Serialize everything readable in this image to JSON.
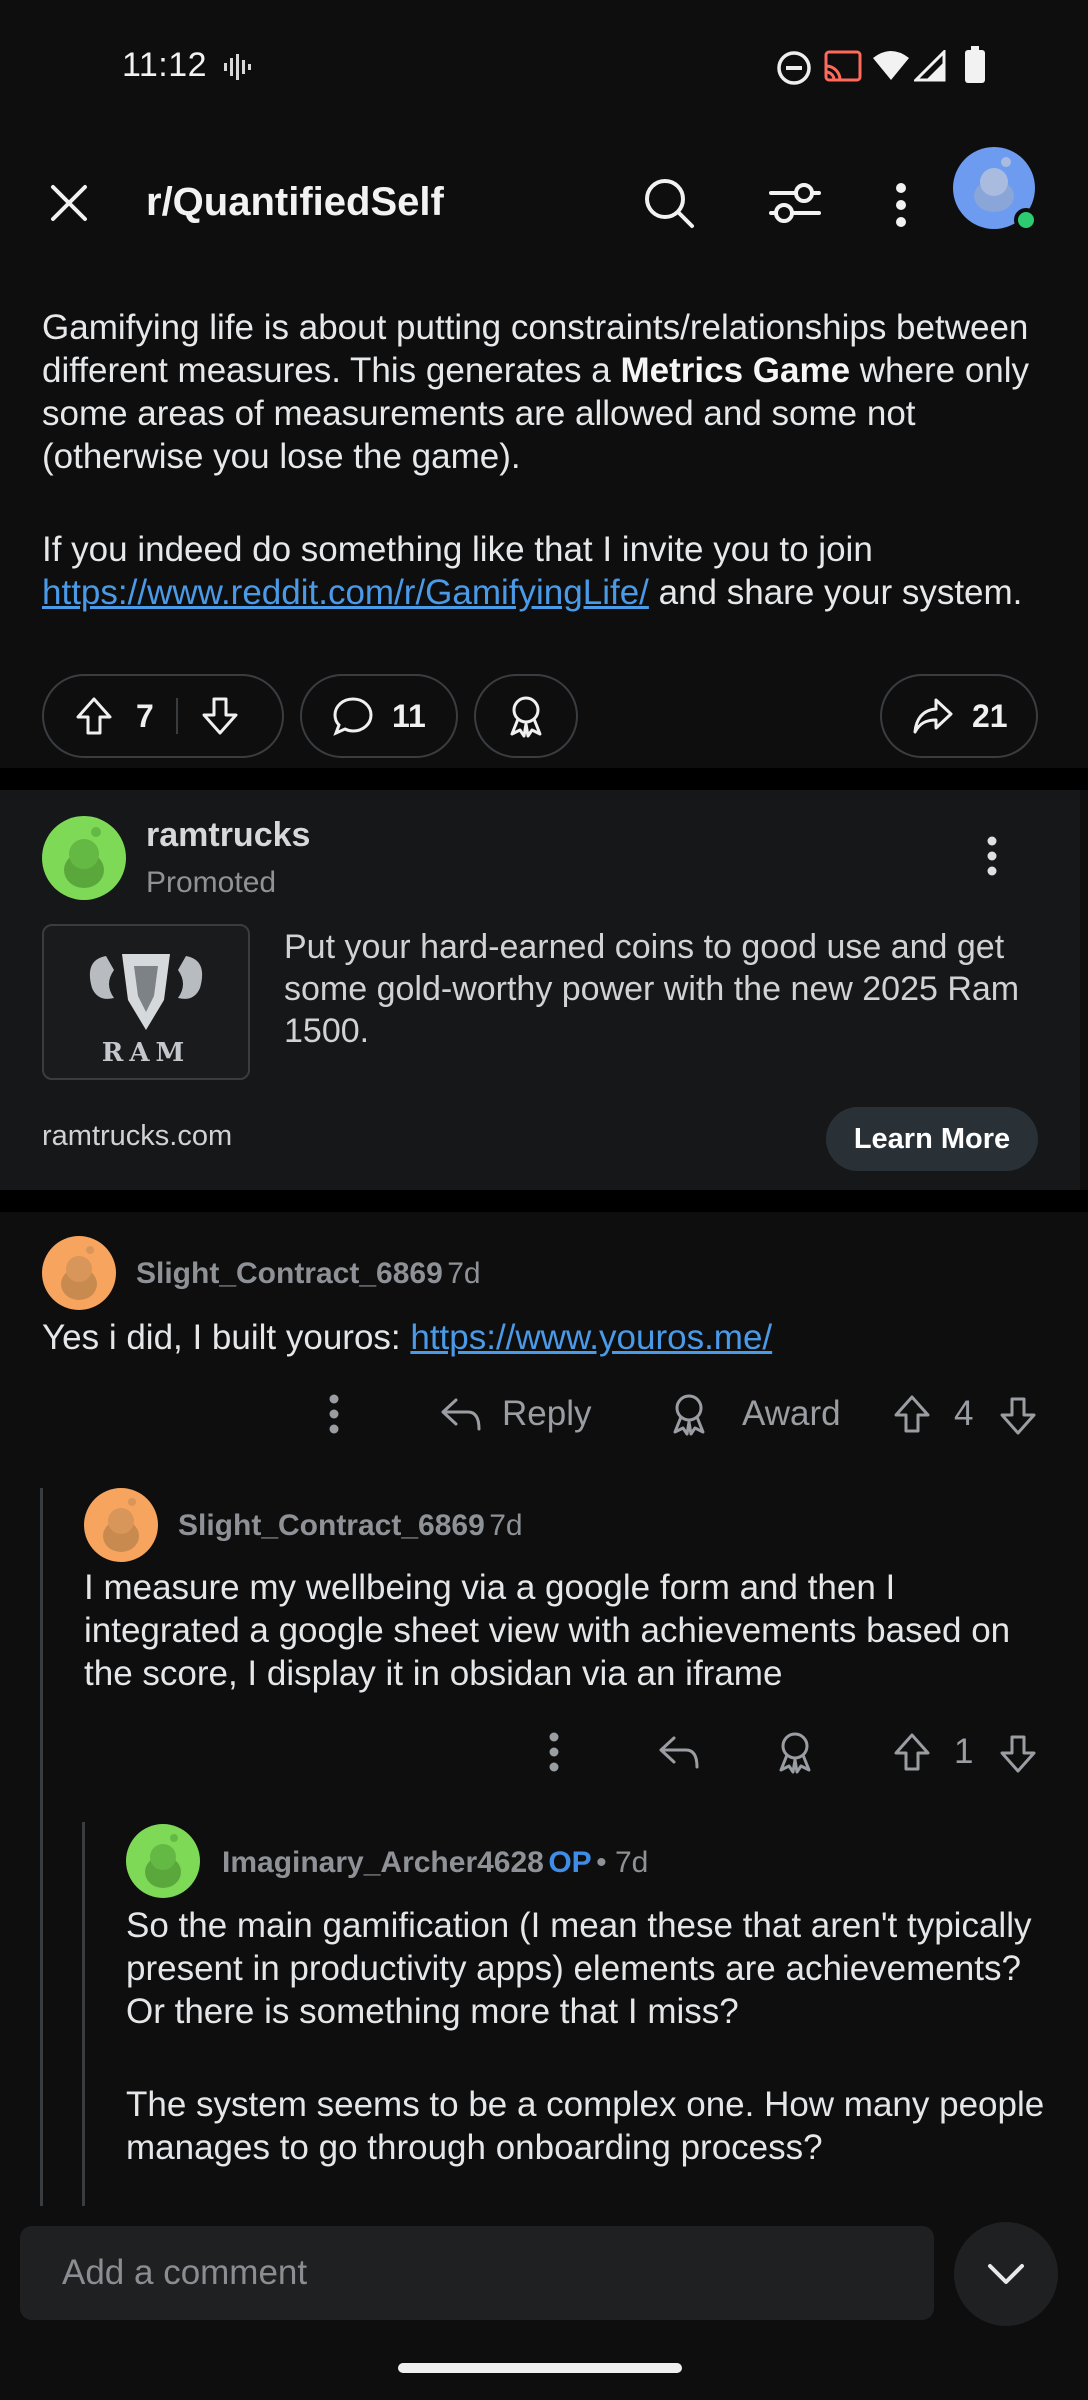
{
  "status_bar": {
    "time": "11:12"
  },
  "header": {
    "subreddit": "r/QuantifiedSelf"
  },
  "post": {
    "para1_a": "Gamifying life is about putting constraints/relationships between different measures. This generates a ",
    "para1_bold": "Metrics Game",
    "para1_b": " where only some areas of measurements are allowed and some not (otherwise you lose the game).",
    "para2_a": "If you indeed do something like that I invite you to join ",
    "para2_link": "https://www.reddit.com/r/GamifyingLife/",
    "para2_b": " and share your system.",
    "votes": "7",
    "comments": "11",
    "shares": "21"
  },
  "ad": {
    "advertiser": "ramtrucks",
    "promoted_label": "Promoted",
    "text": "Put your hard-earned coins to good use and get some gold-worthy power with the new 2025 Ram 1500.",
    "logo_text": "RAM",
    "domain": "ramtrucks.com",
    "cta": "Learn More"
  },
  "comments": [
    {
      "user": "Slight_Contract_6869",
      "age": "7d",
      "body_prefix": "Yes i did, I built youros: ",
      "body_link": "https://www.youros.me/",
      "reply_label": "Reply",
      "award_label": "Award",
      "score": "4"
    },
    {
      "user": "Slight_Contract_6869",
      "age": "7d",
      "body": "I measure my wellbeing via a google form and then I integrated a google sheet view with achievements based on the score, I display it in obsidan via an iframe",
      "score": "1"
    },
    {
      "user": "Imaginary_Archer4628",
      "op_tag": "OP",
      "age": "• 7d",
      "body_p1": "So the main gamification (I mean these that aren't typically present in productivity apps) elements are achievements? Or there is something more that I miss?",
      "body_p2": "The system seems to be a complex one. How many people manages to go through onboarding process?"
    }
  ],
  "composer": {
    "placeholder": "Add a comment"
  },
  "colors": {
    "accent_link": "#4a9ae8",
    "op": "#3e8de6",
    "avatar_green": "#7ed957",
    "avatar_orange": "#f7a45e",
    "avatar_blue": "#6c9bf0"
  }
}
